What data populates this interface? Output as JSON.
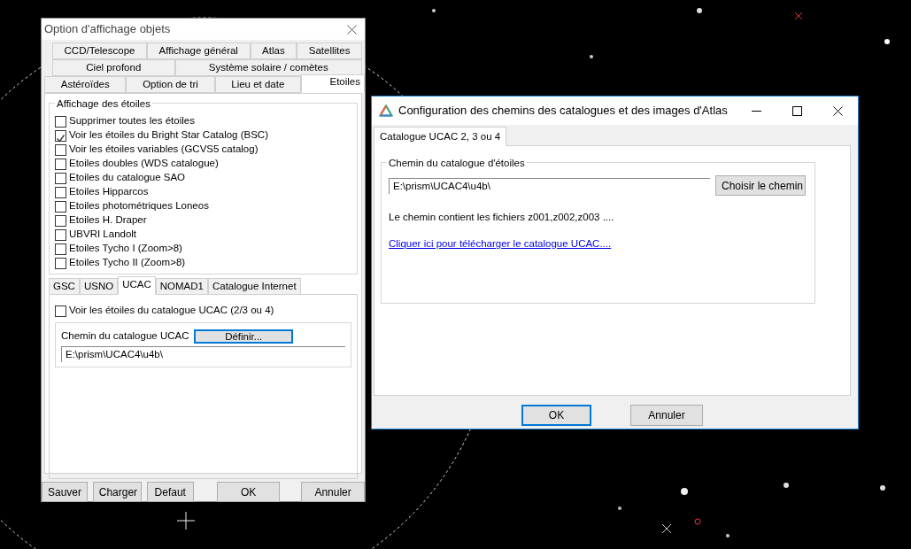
{
  "options_dialog": {
    "title": "Option d'affichage objets",
    "tab_rows": [
      [
        {
          "label": "CCD/Telescope",
          "selected": false
        },
        {
          "label": "Affichage général",
          "selected": false
        },
        {
          "label": "Atlas",
          "selected": false
        },
        {
          "label": "Satellites",
          "selected": false
        }
      ],
      [
        {
          "label": "Ciel profond",
          "selected": false
        },
        {
          "label": "Système solaire / comètes",
          "selected": false
        }
      ],
      [
        {
          "label": "Astéroïdes",
          "selected": false
        },
        {
          "label": "Option de tri",
          "selected": false
        },
        {
          "label": "Lieu et date",
          "selected": false
        },
        {
          "label": "Etoiles",
          "selected": true
        }
      ]
    ],
    "group_title": "Affichage des étoiles",
    "checkboxes": [
      {
        "label": "Supprimer toutes les étoiles",
        "checked": false
      },
      {
        "label": "Voir les étoiles du Bright Star Catalog (BSC)",
        "checked": true
      },
      {
        "label": "Voir les étoiles variables (GCVS5 catalog)",
        "checked": false
      },
      {
        "label": "Etoiles doubles (WDS catalogue)",
        "checked": false
      },
      {
        "label": "Etoiles du catalogue SAO",
        "checked": false
      },
      {
        "label": "Etoiles Hipparcos",
        "checked": false
      },
      {
        "label": "Etoiles photométriques Loneos",
        "checked": false
      },
      {
        "label": "Etoiles H. Draper",
        "checked": false
      },
      {
        "label": "UBVRI Landolt",
        "checked": false
      },
      {
        "label": "Etoiles Tycho I (Zoom>8)",
        "checked": false
      },
      {
        "label": "Etoiles Tycho II (Zoom>8)",
        "checked": false
      }
    ],
    "catalog_tabs": [
      {
        "label": "GSC",
        "selected": false
      },
      {
        "label": "USNO",
        "selected": false
      },
      {
        "label": "UCAC",
        "selected": true
      },
      {
        "label": "NOMAD1",
        "selected": false
      },
      {
        "label": "Catalogue Internet",
        "selected": false
      }
    ],
    "ucac_checkbox": {
      "label": "Voir les étoiles du catalogue UCAC (2/3 ou 4)",
      "checked": false
    },
    "path_label": "Chemin du catalogue UCAC",
    "define_button": "Définir...",
    "path_value": "E:\\prism\\UCAC4\\u4b\\",
    "buttons": [
      "Sauver",
      "Charger",
      "Defaut",
      "OK",
      "Annuler"
    ]
  },
  "paths_dialog": {
    "title": "Configuration des chemins des catalogues et des images d'Atlas",
    "tabs": [
      {
        "label": "Catalogue UCAC 2, 3 ou 4",
        "selected": true
      }
    ],
    "group_title": "Chemin du catalogue d'étoiles",
    "path_value": "E:\\prism\\UCAC4\\u4b\\",
    "choose_button": "Choisir le chemin",
    "info": "Le chemin contient les fichiers z001,z002,z003 ....",
    "download_link": "Cliquer ici pour télécharger le catalogue UCAC....",
    "buttons": [
      "OK",
      "Annuler"
    ]
  }
}
